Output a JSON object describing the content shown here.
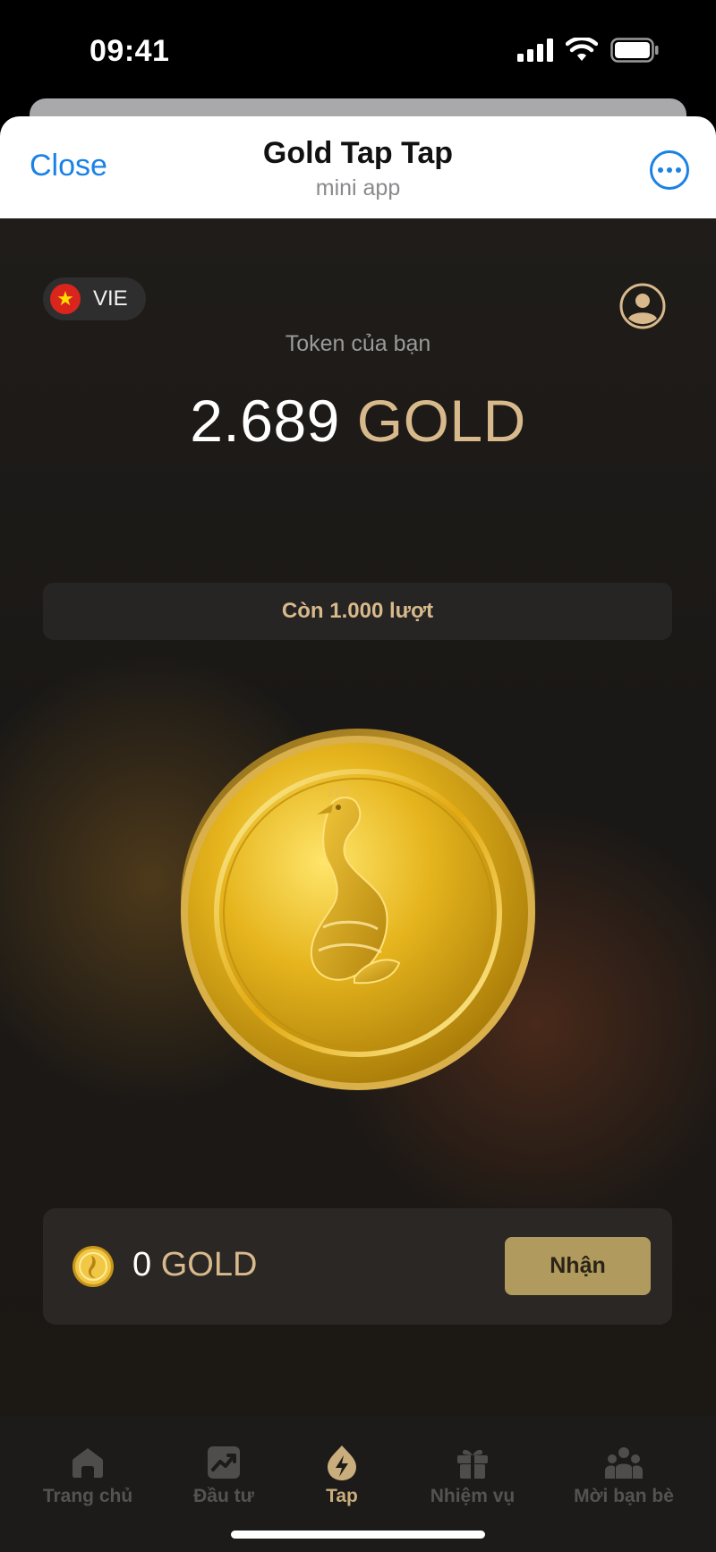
{
  "status_bar": {
    "time": "09:41"
  },
  "header": {
    "close_label": "Close",
    "title": "Gold Tap Tap",
    "subtitle": "mini app"
  },
  "language": {
    "code": "VIE",
    "flag_icon": "vietnam-flag-icon"
  },
  "balance": {
    "label": "Token của bạn",
    "value": "2.689",
    "unit": "GOLD"
  },
  "taps": {
    "remaining_label": "Còn 1.000 lượt"
  },
  "claim": {
    "amount": "0",
    "unit": "GOLD",
    "button_label": "Nhận"
  },
  "nav": {
    "items": [
      {
        "label": "Trang chủ",
        "icon": "home-icon"
      },
      {
        "label": "Đầu tư",
        "icon": "chart-icon"
      },
      {
        "label": "Tap",
        "icon": "tap-icon",
        "active": true
      },
      {
        "label": "Nhiệm vụ",
        "icon": "gift-icon"
      },
      {
        "label": "Mời bạn bè",
        "icon": "friends-icon"
      }
    ]
  },
  "colors": {
    "accent_gold": "#d8b98b",
    "link_blue": "#1a82e6",
    "claim_button": "#b19a5e",
    "background": "#1c1a18"
  }
}
